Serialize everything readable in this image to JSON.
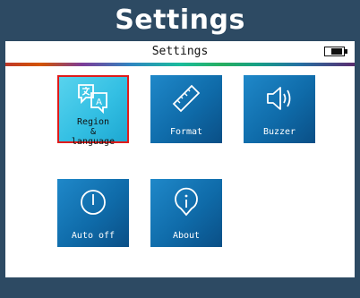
{
  "window": {
    "title": "Settings"
  },
  "status_bar": {
    "title": "Settings",
    "battery_icon": "battery-icon"
  },
  "colors": {
    "frame": "#2d4a63",
    "tile": "#1379bb",
    "tile_selected": "#3ec6e6",
    "selection_border": "#e01b1b"
  },
  "tiles": [
    {
      "id": "region-language",
      "icon": "region-language-icon",
      "label_lines": [
        "Region",
        "&",
        "language"
      ],
      "selected": true
    },
    {
      "id": "format",
      "icon": "ruler-icon",
      "label": "Format",
      "selected": false
    },
    {
      "id": "buzzer",
      "icon": "speaker-icon",
      "label": "Buzzer",
      "selected": false
    },
    {
      "id": "auto-off",
      "icon": "power-icon",
      "label": "Auto off",
      "selected": false
    },
    {
      "id": "about",
      "icon": "info-icon",
      "label": "About",
      "selected": false
    }
  ]
}
